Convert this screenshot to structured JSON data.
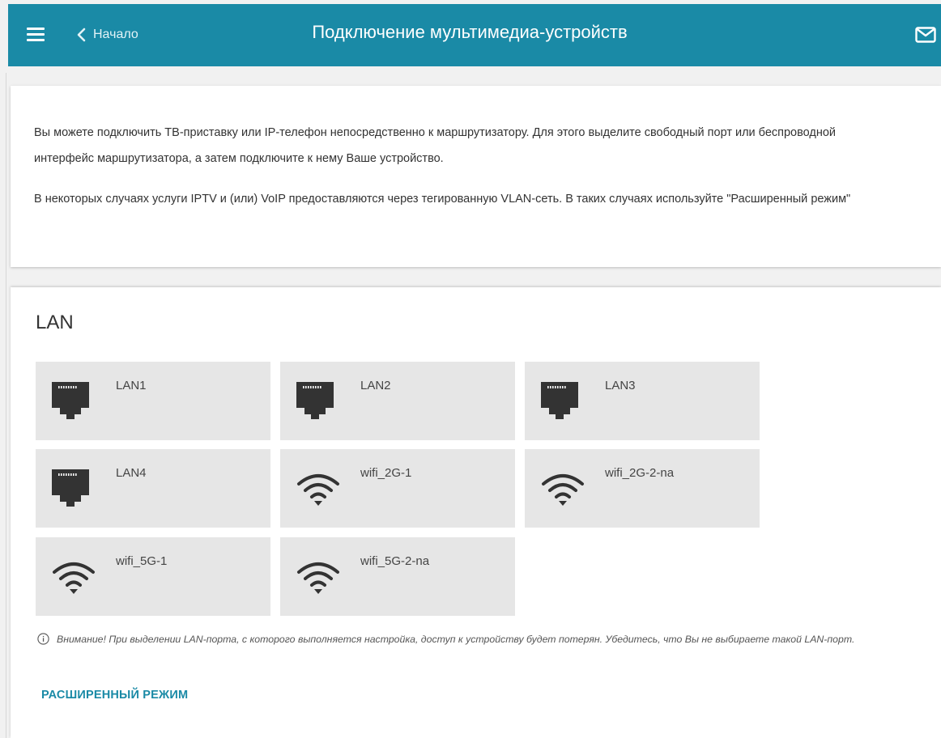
{
  "header": {
    "back_label": "Начало",
    "title": "Подключение мультимедиа-устройств",
    "accent_color": "#1a8aa6",
    "icons": {
      "menu": "hamburger-menu-icon",
      "back": "chevron-left-icon",
      "mail": "mail-icon"
    }
  },
  "info": {
    "paragraph1": "Вы можете подключить ТВ-приставку или IP-телефон непосредственно к маршрутизатору. Для этого выделите свободный порт или беспроводной интерфейс маршрутизатора, а затем подключите к нему Ваше устройство.",
    "paragraph2": "В некоторых случаях услуги IPTV и (или) VoIP предоставляются через тегированную VLAN-сеть. В таких случаях используйте \"Расширенный режим\""
  },
  "lan": {
    "title": "LAN",
    "ports": [
      {
        "label": "LAN1",
        "icon": "ethernet-port-icon"
      },
      {
        "label": "LAN2",
        "icon": "ethernet-port-icon"
      },
      {
        "label": "LAN3",
        "icon": "ethernet-port-icon"
      },
      {
        "label": "LAN4",
        "icon": "ethernet-port-icon"
      },
      {
        "label": "wifi_2G-1",
        "icon": "wifi-icon"
      },
      {
        "label": "wifi_2G-2-na",
        "icon": "wifi-icon"
      },
      {
        "label": "wifi_5G-1",
        "icon": "wifi-icon"
      },
      {
        "label": "wifi_5G-2-na",
        "icon": "wifi-icon"
      }
    ],
    "notice": "Внимание! При выделении LAN-порта, с которого выполняется настройка, доступ к устройству будет потерян. Убедитесь, что Вы не выбираете такой LAN-порт.",
    "notice_icon": "info-icon",
    "advanced_label": "РАСШИРЕННЫЙ РЕЖИМ"
  }
}
